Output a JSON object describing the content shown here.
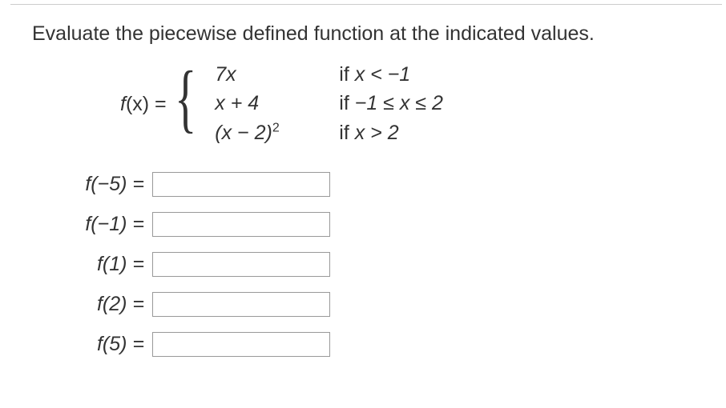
{
  "prompt": "Evaluate the piecewise defined function at the indicated values.",
  "fx_label_f": "f",
  "fx_label_rest": "(x) = ",
  "pieces": [
    {
      "expr": "7x",
      "cond_if": "if ",
      "cond_rest": "x < −1"
    },
    {
      "expr": "x + 4",
      "cond_if": "if ",
      "cond_rest": "−1 ≤ x ≤ 2"
    },
    {
      "expr": "(x − 2)",
      "exp": "2",
      "cond_if": "if ",
      "cond_rest": "x > 2"
    }
  ],
  "answers": [
    {
      "label": "f(−5) = "
    },
    {
      "label": "f(−1) = "
    },
    {
      "label": "f(1) = "
    },
    {
      "label": "f(2) = "
    },
    {
      "label": "f(5) = "
    }
  ]
}
